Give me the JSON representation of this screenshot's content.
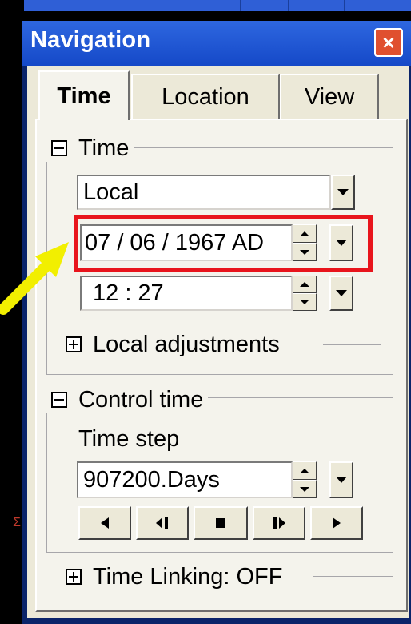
{
  "window": {
    "title": "Navigation",
    "close_label": "×"
  },
  "tabs": [
    {
      "label": "Time",
      "active": true
    },
    {
      "label": "Location",
      "active": false
    },
    {
      "label": "View",
      "active": false
    }
  ],
  "time_group": {
    "title": "Time",
    "mode_select": {
      "value": "Local"
    },
    "date_field": {
      "value": "07 / 06 / 1967 AD"
    },
    "time_field": {
      "value": "12 : 27"
    },
    "local_adjustments": {
      "label": "Local adjustments"
    }
  },
  "control_group": {
    "title": "Control time",
    "time_step_label": "Time step",
    "time_step_field": {
      "value": "907200.Days"
    }
  },
  "linking": {
    "label": "Time Linking: OFF"
  },
  "side_mark": "Σ",
  "colors": {
    "highlight": "#e8141c",
    "arrow": "#f2ef00",
    "titlebar": "#2456d8"
  }
}
